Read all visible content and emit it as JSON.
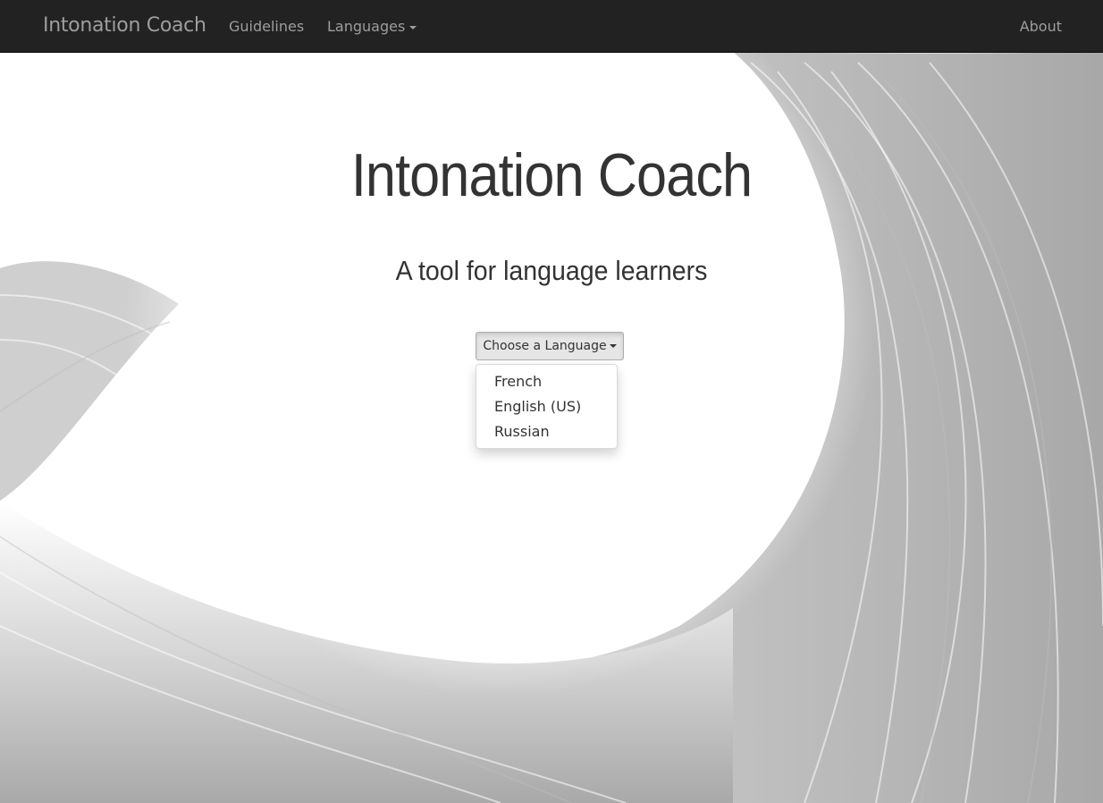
{
  "navbar": {
    "brand": "Intonation Coach",
    "items": [
      {
        "label": "Guidelines"
      },
      {
        "label": "Languages"
      }
    ],
    "about": "About",
    "background_color": "#222222",
    "text_color": "#9d9d9d"
  },
  "hero": {
    "title": "Intonation Coach",
    "subtitle": "A tool for language learners"
  },
  "language_dropdown": {
    "button_label": "Choose a Language",
    "expanded": true,
    "options": [
      {
        "label": "French"
      },
      {
        "label": "English (US)"
      },
      {
        "label": "Russian"
      }
    ]
  },
  "icons": {
    "nav_caret": "caret-down-icon",
    "dropdown_caret": "caret-down-icon"
  }
}
